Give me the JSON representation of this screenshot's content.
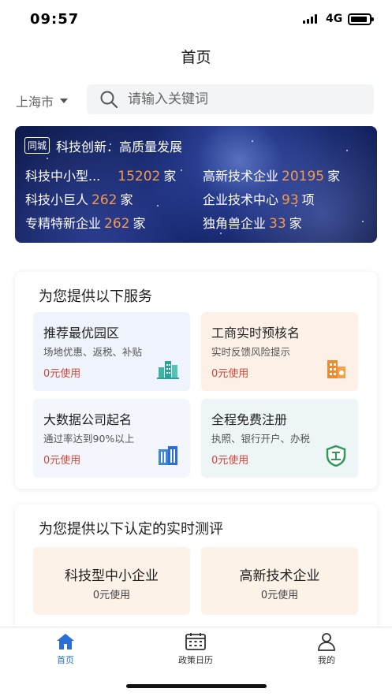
{
  "status": {
    "time": "09:57",
    "network": "4G"
  },
  "nav": {
    "title": "首页"
  },
  "location": {
    "city": "上海市"
  },
  "search": {
    "placeholder": "请输入关键词"
  },
  "banner": {
    "tag": "同城",
    "headline": "科技创新．高质量发展",
    "stats": [
      {
        "label": "科技中小型...",
        "value": "15202",
        "unit": "家"
      },
      {
        "label": "高新技术企业",
        "value": "20195",
        "unit": "家"
      },
      {
        "label": "科技小巨人",
        "value": "262",
        "unit": "家"
      },
      {
        "label": "企业技术中心",
        "value": "93",
        "unit": "项"
      },
      {
        "label": "专精特新企业",
        "value": "262",
        "unit": "家"
      },
      {
        "label": "独角兽企业",
        "value": "33",
        "unit": "家"
      }
    ]
  },
  "services": {
    "title": "为您提供以下服务",
    "items": [
      {
        "title": "推荐最优园区",
        "desc": "场地优惠、返税、补贴",
        "price": "0元使用",
        "icon": "buildings-icon",
        "bg": "#eef3fc"
      },
      {
        "title": "工商实时预核名",
        "desc": "实时反馈风险提示",
        "price": "0元使用",
        "icon": "office-building-icon",
        "bg": "#fdf1e7"
      },
      {
        "title": "大数据公司起名",
        "desc": "通过率达到90%以上",
        "price": "0元使用",
        "icon": "tower-icon",
        "bg": "#f3f7fd"
      },
      {
        "title": "全程免费注册",
        "desc": "执照、银行开户、办税",
        "price": "0元使用",
        "icon": "shield-icon",
        "bg": "#eef5f7"
      }
    ]
  },
  "evaluation": {
    "title": "为您提供以下认定的实时测评",
    "items": [
      {
        "title": "科技型中小企业",
        "price": "0元使用"
      },
      {
        "title": "高新技术企业",
        "price": "0元使用"
      }
    ]
  },
  "tabbar": [
    {
      "label": "首页",
      "icon": "home-icon",
      "active": true
    },
    {
      "label": "政策日历",
      "icon": "calendar-icon",
      "active": false
    },
    {
      "label": "我的",
      "icon": "user-icon",
      "active": false
    }
  ],
  "colors": {
    "accent": "#2b6fd6",
    "price": "#d0473b",
    "number": "#f39a4c"
  }
}
